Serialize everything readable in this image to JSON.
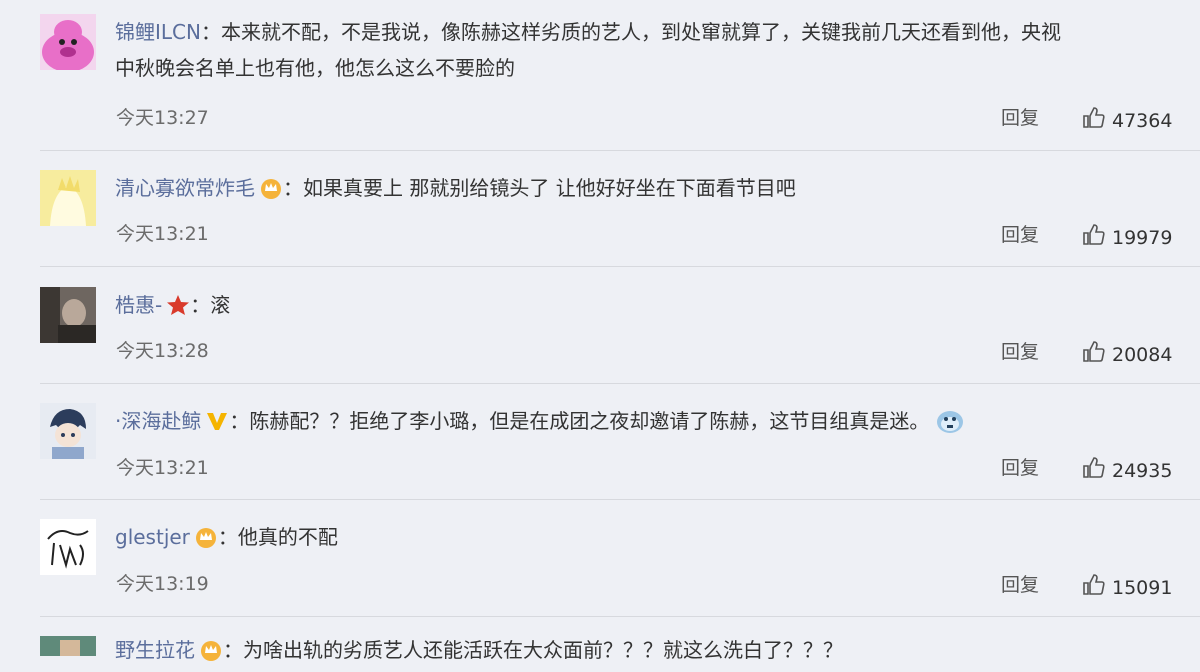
{
  "reply_label": "回复",
  "colors": {
    "username": "#5b6e9c",
    "divider": "#d7d9de",
    "background": "#eef0f5"
  },
  "comments": [
    {
      "username": "锦鲤ILCN",
      "separator": "：",
      "text_line1": "本来就不配，不是我说，像陈赫这样劣质的艺人，到处窜就算了，关键我前几天还看到他，央视",
      "text_line2": "中秋晚会名单上也有他，他怎么这么不要脸的",
      "time": "今天13:27",
      "likes": "47364",
      "avatar_icon": "pink-blob-avatar"
    },
    {
      "username": "清心寡欲常炸毛",
      "badge": "crown-icon",
      "separator": "：",
      "text_line1": "如果真要上 那就别给镜头了 让他好好坐在下面看节目吧",
      "time": "今天13:21",
      "likes": "19979",
      "avatar_icon": "yellow-cartoon-avatar"
    },
    {
      "username": "梏惠-",
      "badge": "star-icon",
      "separator": "：",
      "text_line1": "滚",
      "time": "今天13:28",
      "likes": "20084",
      "avatar_icon": "photo-avatar"
    },
    {
      "username": "·深海赴鲸",
      "badge": "v-icon",
      "separator": "：",
      "text_line1": "陈赫配？？拒绝了李小璐，但是在成团之夜却邀请了陈赫，这节目组真是迷。",
      "time": "今天13:21",
      "likes": "24935",
      "avatar_icon": "anime-avatar",
      "emoji": "cold-face-emoji"
    },
    {
      "username": "glestjer",
      "badge": "crown-icon",
      "separator": "：",
      "text_line1": "他真的不配",
      "time": "今天13:19",
      "likes": "15091",
      "avatar_icon": "sketch-avatar"
    },
    {
      "username": "野生拉花",
      "badge": "crown-icon",
      "separator": "：",
      "text_line1": "为啥出轨的劣质艺人还能活跃在大众面前？？？就这么洗白了？？？",
      "avatar_icon": "photo-avatar-2"
    }
  ]
}
